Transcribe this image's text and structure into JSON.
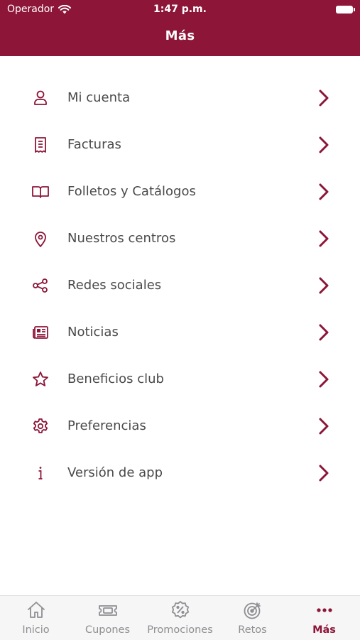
{
  "status_bar": {
    "carrier": "Operador",
    "time": "1:47 p.m."
  },
  "header": {
    "title": "Más"
  },
  "menu": [
    {
      "label": "Mi cuenta",
      "icon": "user-icon"
    },
    {
      "label": "Facturas",
      "icon": "receipt-icon"
    },
    {
      "label": "Folletos y Catálogos",
      "icon": "book-icon"
    },
    {
      "label": "Nuestros centros",
      "icon": "location-pin-icon"
    },
    {
      "label": "Redes sociales",
      "icon": "share-icon"
    },
    {
      "label": "Noticias",
      "icon": "newspaper-icon"
    },
    {
      "label": "Beneficios club",
      "icon": "star-icon"
    },
    {
      "label": "Preferencias",
      "icon": "gear-icon"
    },
    {
      "label": "Versión de app",
      "icon": "info-icon"
    }
  ],
  "tabbar": {
    "tabs": [
      {
        "label": "Inicio",
        "icon": "home-icon",
        "active": false
      },
      {
        "label": "Cupones",
        "icon": "ticket-icon",
        "active": false
      },
      {
        "label": "Promociones",
        "icon": "percent-badge-icon",
        "active": false
      },
      {
        "label": "Retos",
        "icon": "target-icon",
        "active": false
      },
      {
        "label": "Más",
        "icon": "more-dots-icon",
        "active": true
      }
    ]
  },
  "colors": {
    "brand": "#8c1538",
    "text": "#4a4a4a",
    "tab_inactive": "#8e8e93"
  }
}
